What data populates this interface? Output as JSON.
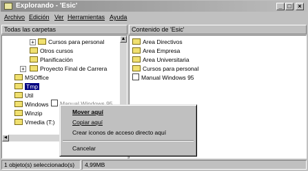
{
  "window": {
    "title": "Explorando - 'Esic'"
  },
  "title_buttons": {
    "minimize": "_",
    "maximize": "□",
    "close": "×"
  },
  "menu": [
    "Archivo",
    "Edición",
    "Ver",
    "Herramientas",
    "Ayuda"
  ],
  "left_pane": {
    "header": "Todas las carpetas",
    "tree": [
      {
        "label": "Cursos para personal",
        "expander": "+"
      },
      {
        "label": "Otros cursos",
        "expander": ""
      },
      {
        "label": "Planificación",
        "expander": ""
      },
      {
        "label": "Proyecto Final de Carrera",
        "expander": "+"
      },
      {
        "label": "MSOffice",
        "expander": ""
      },
      {
        "label": "Tmp",
        "expander": ""
      },
      {
        "label": "Util",
        "expander": ""
      },
      {
        "label": "Windows",
        "expander": ""
      },
      {
        "label": "Winzip",
        "expander": ""
      },
      {
        "label": "Vmedia (T:)",
        "expander": ""
      }
    ],
    "drag_label": "Manual Windows 95"
  },
  "right_pane": {
    "header": "Contenido de 'Esic'",
    "items": [
      "Area Directivos",
      "Area Empresa",
      "Area Universitaria",
      "Cursos para personal",
      "Manual Windows 95"
    ]
  },
  "context_menu": {
    "items": [
      {
        "label": "Mover aquí",
        "bold": true
      },
      {
        "label": "Copiar aquí",
        "bold": false
      },
      {
        "label": "Crear iconos de acceso directo aquí",
        "bold": false
      },
      {
        "label": "Cancelar",
        "bold": false
      }
    ]
  },
  "status": {
    "selection": "1 objeto(s) seleccionado(s)",
    "size": "4,99MB"
  }
}
